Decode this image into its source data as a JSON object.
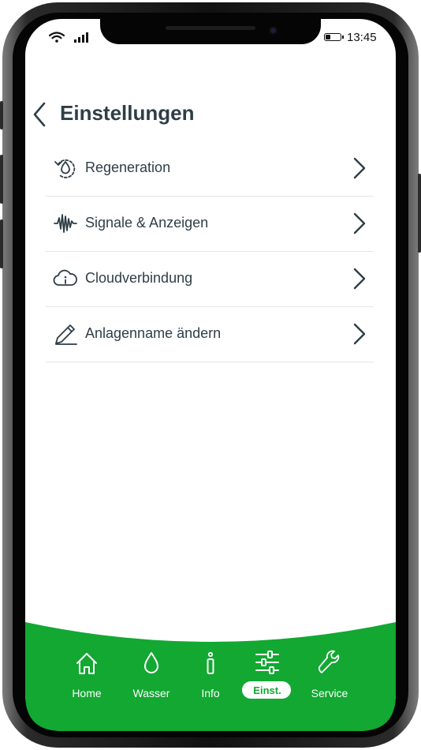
{
  "status_bar": {
    "time": "13:45"
  },
  "header": {
    "title": "Einstellungen"
  },
  "menu": [
    {
      "label": "Regeneration",
      "icon": "regeneration-icon"
    },
    {
      "label": "Signale & Anzeigen",
      "icon": "signal-wave-icon"
    },
    {
      "label": "Cloudverbindung",
      "icon": "cloud-info-icon"
    },
    {
      "label": "Anlagenname ändern",
      "icon": "pencil-icon"
    }
  ],
  "tabs": [
    {
      "label": "Home",
      "icon": "home-icon",
      "active": false
    },
    {
      "label": "Wasser",
      "icon": "water-drop-icon",
      "active": false
    },
    {
      "label": "Info",
      "icon": "info-icon",
      "active": false
    },
    {
      "label": "Einst.",
      "icon": "sliders-icon",
      "active": true
    },
    {
      "label": "Service",
      "icon": "wrench-icon",
      "active": false
    }
  ],
  "colors": {
    "accent": "#12a832",
    "text": "#2f3e46",
    "divider": "#e3e6e8"
  }
}
